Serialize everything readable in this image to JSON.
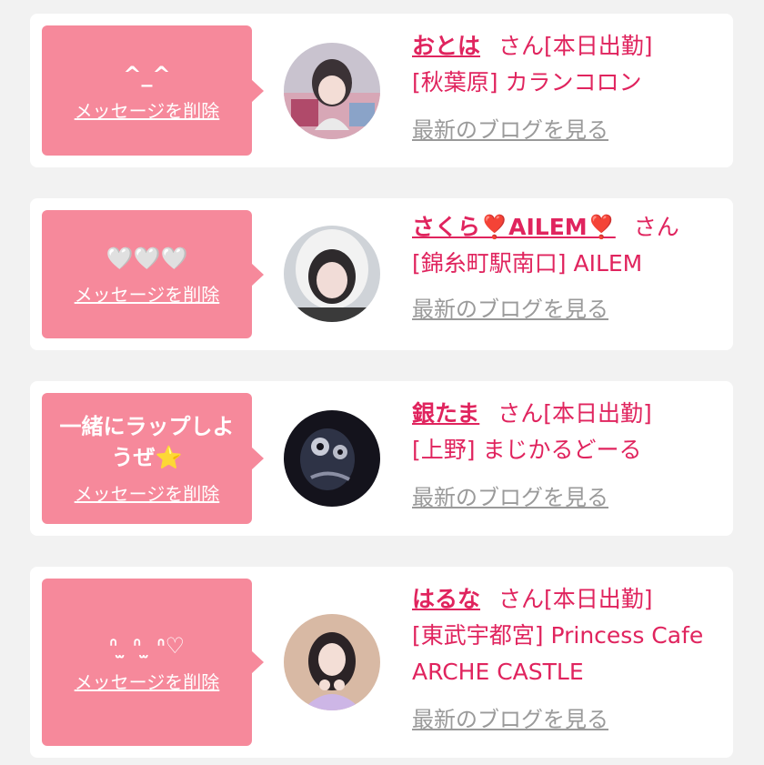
{
  "colors": {
    "background": "#f2f2f2",
    "card": "#ffffff",
    "bubble": "#f6899b",
    "accent_text": "#e0245e",
    "blog_link": "#9a9a9a"
  },
  "delete_label": "メッセージを削除",
  "blog_label": "最新のブログを見る",
  "cards": [
    {
      "message": "^_^",
      "name": "おとは",
      "honorific": "さん",
      "status": "[本日出勤]",
      "location": "[秋葉原]",
      "shop": "カランコロン"
    },
    {
      "message": "🤍🤍🤍",
      "name": "さくら❣️AILEM❣️",
      "honorific": "さん",
      "status": "",
      "location": "[錦糸町駅南口]",
      "shop": "AILEM"
    },
    {
      "message": "一緒にラップしようぜ⭐",
      "name": "銀たま",
      "honorific": "さん",
      "status": "[本日出勤]",
      "location": "[上野]",
      "shop": "まじかるどーる"
    },
    {
      "message": "ᐢ ̫ ᐢ ̫ ᐢ♡",
      "name": "はるな",
      "honorific": "さん",
      "status": "[本日出勤]",
      "location": "[東武宇都宮]",
      "shop": "Princess Cafe ARCHE CASTLE"
    }
  ]
}
